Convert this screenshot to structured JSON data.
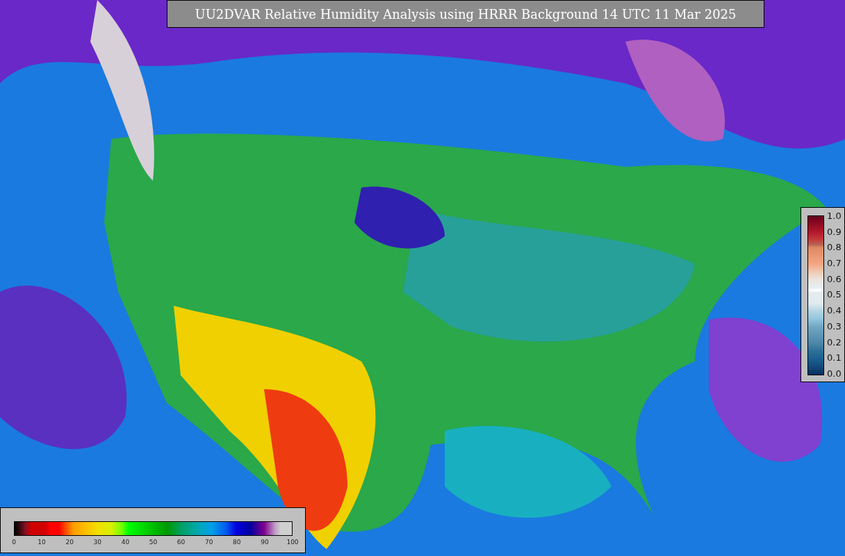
{
  "title": "UU2DVAR Relative Humidity Analysis using HRRR Background 14 UTC 11 Mar 2025",
  "ratio_colorbar": {
    "ticks": [
      "1.0",
      "0.9",
      "0.8",
      "0.7",
      "0.6",
      "0.5",
      "0.4",
      "0.3",
      "0.2",
      "0.1",
      "0.0"
    ]
  },
  "humidity_colorbar": {
    "ticks": [
      "0",
      "10",
      "20",
      "30",
      "40",
      "50",
      "60",
      "70",
      "80",
      "90",
      "100"
    ]
  }
}
